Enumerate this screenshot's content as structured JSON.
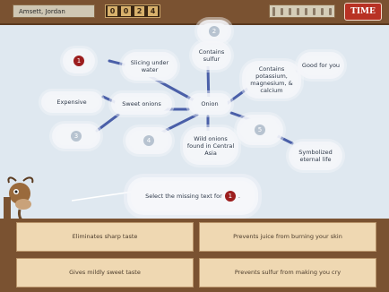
{
  "player": {
    "name": "Amsett, Jordan"
  },
  "score": {
    "digits": [
      "0",
      "0",
      "2",
      "4"
    ]
  },
  "time_button": {
    "label": "TIME"
  },
  "web": {
    "center": "Onion",
    "nodes": [
      {
        "id": "slicing",
        "text": "Slicing under water"
      },
      {
        "id": "contains-sulfur",
        "text": "Contains sulfur"
      },
      {
        "id": "contains-potassium",
        "text": "Contains potassium, magnesium, & calcium"
      },
      {
        "id": "good-for-you",
        "text": "Good for you"
      },
      {
        "id": "expensive",
        "text": "Expensive"
      },
      {
        "id": "sweet-onions",
        "text": "Sweet onions"
      },
      {
        "id": "wild-onions",
        "text": "Wild onions found in Central Asia"
      },
      {
        "id": "symbolized",
        "text": "Symbolized eternal life"
      }
    ],
    "blanks": [
      "1",
      "2",
      "3",
      "4",
      "5"
    ]
  },
  "prompt": {
    "text": "Select the missing text for",
    "number": "1",
    "end": "."
  },
  "answers": [
    {
      "label": "Eliminates sharp taste"
    },
    {
      "label": "Prevents juice from burning your skin"
    },
    {
      "label": "Gives mildly sweet taste"
    },
    {
      "label": "Prevents sulfur from making you cry"
    }
  ]
}
